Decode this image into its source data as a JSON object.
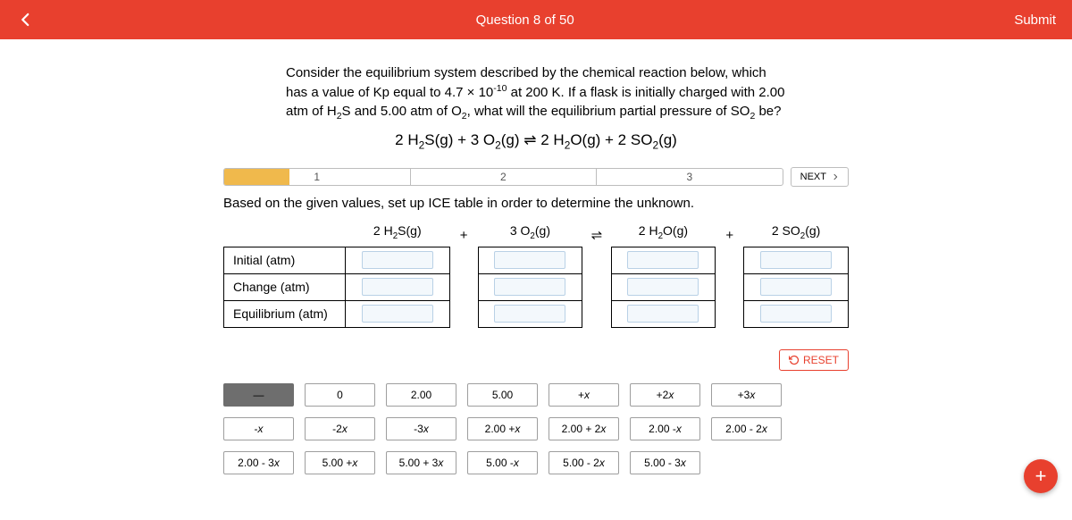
{
  "header": {
    "title": "Question 8 of 50",
    "submit": "Submit"
  },
  "prompt_html": "Consider the equilibrium system described by the chemical reaction below, which has a value of Kp equal to 4.7 × 10<span class='sup'>-10</span> at 200 K. If a flask is initially charged with 2.00 atm of H<span class='sub'>2</span>S and 5.00 atm of O<span class='sub'>2</span>, what will the equilibrium partial pressure of SO<span class='sub'>2</span> be?",
  "equation_html": "2 H<span class='sub'>2</span>S(g) + 3 O<span class='sub'>2</span>(g) ⇌ 2 H<span class='sub'>2</span>O(g) + 2 SO<span class='sub'>2</span>(g)",
  "progress": {
    "segments": [
      "1",
      "2",
      "3"
    ],
    "next": "NEXT"
  },
  "instruction": "Based on the given values, set up ICE table in order to determine the unknown.",
  "ice": {
    "cols_html": [
      "2 H<span class='sub'>2</span>S(g)",
      "3 O<span class='sub'>2</span>(g)",
      "2 H<span class='sub'>2</span>O(g)",
      "2 SO<span class='sub'>2</span>(g)"
    ],
    "ops": [
      "+",
      "⇌",
      "+"
    ],
    "rows": [
      "Initial (atm)",
      "Change (atm)",
      "Equilibrium (atm)"
    ]
  },
  "reset": "RESET",
  "tiles": [
    {
      "label": "—",
      "dark": true
    },
    {
      "label": "0"
    },
    {
      "label": "2.00"
    },
    {
      "label": "5.00"
    },
    {
      "label": "+<span class='ital'>x</span>"
    },
    {
      "label": "+2<span class='ital'>x</span>"
    },
    {
      "label": "+3<span class='ital'>x</span>"
    },
    {
      "label": "-<span class='ital'>x</span>"
    },
    {
      "label": "-2<span class='ital'>x</span>"
    },
    {
      "label": "-3<span class='ital'>x</span>"
    },
    {
      "label": "2.00 + <span class='ital'>x</span>"
    },
    {
      "label": "2.00 + 2<span class='ital'>x</span>"
    },
    {
      "label": "2.00 - <span class='ital'>x</span>"
    },
    {
      "label": "2.00 - 2<span class='ital'>x</span>"
    },
    {
      "label": "2.00 - 3<span class='ital'>x</span>"
    },
    {
      "label": "5.00 + <span class='ital'>x</span>"
    },
    {
      "label": "5.00 + 3<span class='ital'>x</span>"
    },
    {
      "label": "5.00 - <span class='ital'>x</span>"
    },
    {
      "label": "5.00 - 2<span class='ital'>x</span>"
    },
    {
      "label": "5.00 - 3<span class='ital'>x</span>"
    }
  ],
  "fab": "+"
}
